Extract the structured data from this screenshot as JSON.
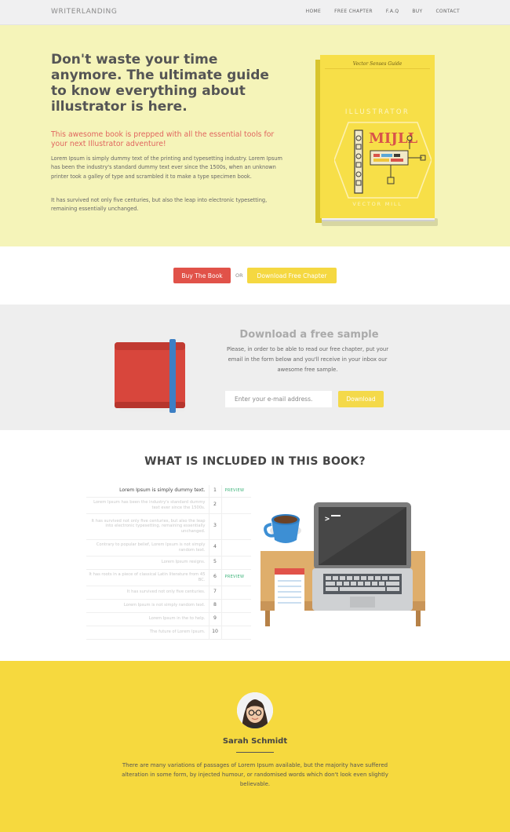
{
  "nav": {
    "logo": "WRITERLANDING",
    "links": [
      "HOME",
      "FREE CHAPTER",
      "F.A.Q",
      "BUY",
      "CONTACT"
    ]
  },
  "hero": {
    "title": "Don't waste your time anymore. The ultimate guide to know everything about illustrator is here.",
    "subtitle": "This awesome book is prepped with all the essential tools for your next Illustrator adventure!",
    "paragraph_1": "Lorem Ipsum is simply dummy text of the printing and typesetting industry. Lorem Ipsum has been the industry's standard dummy text ever since the 1500s, when an unknown printer took a galley of type and scrambled it to make a type specimen book.",
    "paragraph_2": "It has survived not only five centuries, but also the leap into electronic typesetting, remaining essentially unchanged.",
    "book": {
      "series": "Vector Senses Guide",
      "category": "ILLUSTRATOR",
      "logo": "MIJLL",
      "author": "VECTOR MILL"
    }
  },
  "cta": {
    "buy_label": "Buy The Book",
    "or_label": "OR",
    "chapter_label": "Download Free Chapter"
  },
  "sample": {
    "title": "Download a free sample",
    "text": "Please, in order to be able to read our free chapter, put your email in the form below and you'll receive in your inbox our awesome free sample.",
    "email_placeholder": "Enter your e-mail address.",
    "download_label": "Download"
  },
  "contents": {
    "title": "WHAT IS INCLUDED IN THIS BOOK?",
    "rows": [
      {
        "text": "Lorem Ipsum is simply dummy text.",
        "num": "1",
        "preview": "PREVIEW"
      },
      {
        "text": "Lorem Ipsum has been the industry's standard dummy text ever since the 1500s.",
        "num": "2",
        "preview": ""
      },
      {
        "text": "It has survived not only five centuries, but also the leap into electronic typesetting, remaining essentially unchanged.",
        "num": "3",
        "preview": ""
      },
      {
        "text": "Contrary to popular belief, Lorem Ipsum is not simply random text.",
        "num": "4",
        "preview": ""
      },
      {
        "text": "Lorem Ipsum resigns.",
        "num": "5",
        "preview": ""
      },
      {
        "text": "It has roots in a piece of classical Latin literature from 45 BC.",
        "num": "6",
        "preview": "PREVIEW"
      },
      {
        "text": "It has survived not only five centuries.",
        "num": "7",
        "preview": ""
      },
      {
        "text": "Lorem Ipsum is not simply random text.",
        "num": "8",
        "preview": ""
      },
      {
        "text": "Lorem Ipsum in the to help.",
        "num": "9",
        "preview": ""
      },
      {
        "text": "The future of Lorem Ipsum.",
        "num": "10",
        "preview": ""
      }
    ]
  },
  "author": {
    "name": "Sarah Schmidt",
    "bio": "There are many variations of passages of Lorem Ipsum available, but the majority have suffered alteration in some form, by injected humour, or randomised words which don't look even slightly believable."
  },
  "colors": {
    "hero_bg": "#f5f4b9",
    "accent_red": "#e15249",
    "accent_yellow": "#f5d841",
    "author_bg": "#f6d93e",
    "preview_green": "#3db37a"
  }
}
